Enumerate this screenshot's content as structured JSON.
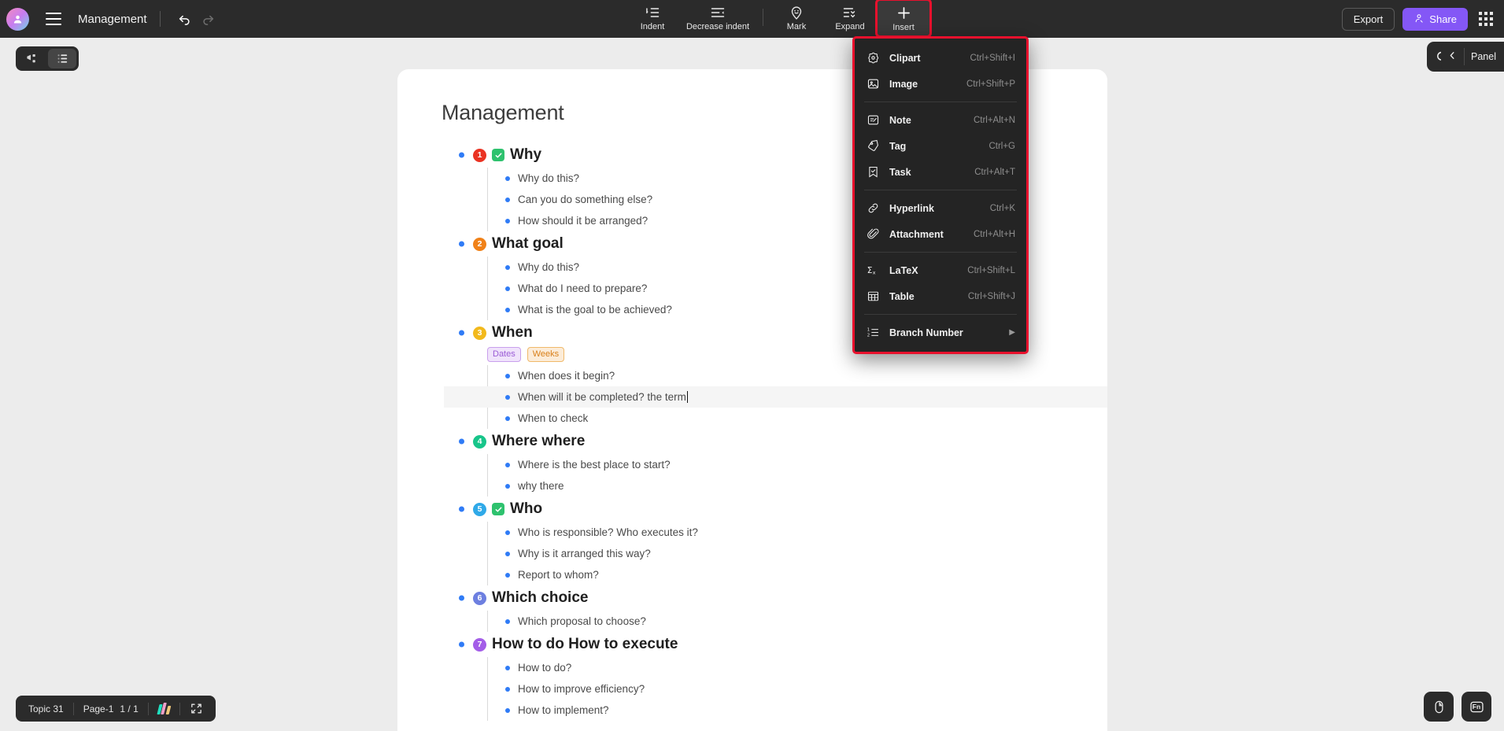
{
  "topbar": {
    "avatar_icon": "user-avatar-icon",
    "menu_icon": "hamburger-menu-icon",
    "title": "Management",
    "undo_icon": "undo-icon",
    "redo_icon": "redo-icon",
    "tools": [
      {
        "label": "Indent",
        "icon": "indent-icon"
      },
      {
        "label": "Decrease indent",
        "icon": "decrease-indent-icon"
      },
      {
        "label": "Mark",
        "icon": "mark-pin-icon"
      },
      {
        "label": "Expand",
        "icon": "expand-list-icon"
      },
      {
        "label": "Insert",
        "icon": "plus-icon"
      }
    ],
    "export_label": "Export",
    "share_label": "Share",
    "share_icon": "person-share-icon",
    "apps_icon": "apps-grid-icon",
    "accent_color": "#8457f6",
    "highlight_color": "#e8112d"
  },
  "insert_menu": {
    "items": [
      {
        "label": "Clipart",
        "shortcut": "Ctrl+Shift+I",
        "icon": "clipart-icon"
      },
      {
        "label": "Image",
        "shortcut": "Ctrl+Shift+P",
        "icon": "image-icon"
      },
      {
        "label": "Note",
        "shortcut": "Ctrl+Alt+N",
        "icon": "note-icon"
      },
      {
        "label": "Tag",
        "shortcut": "Ctrl+G",
        "icon": "tag-icon"
      },
      {
        "label": "Task",
        "shortcut": "Ctrl+Alt+T",
        "icon": "task-icon"
      },
      {
        "label": "Hyperlink",
        "shortcut": "Ctrl+K",
        "icon": "link-icon"
      },
      {
        "label": "Attachment",
        "shortcut": "Ctrl+Alt+H",
        "icon": "paperclip-icon"
      },
      {
        "label": "LaTeX",
        "shortcut": "Ctrl+Shift+L",
        "icon": "sigma-icon"
      },
      {
        "label": "Table",
        "shortcut": "Ctrl+Shift+J",
        "icon": "table-icon"
      },
      {
        "label": "Branch Number",
        "shortcut": "",
        "icon": "branch-number-icon",
        "submenu": true
      }
    ]
  },
  "view_toggle": {
    "mindmap_icon": "mindmap-view-icon",
    "outline_icon": "outline-view-icon",
    "selected": "outline"
  },
  "search": {
    "icon": "search-icon"
  },
  "panel": {
    "label": "Panel",
    "collapse_icon": "chevron-left-icon"
  },
  "statusbar": {
    "topic_count": "Topic 31",
    "page_label": "Page-1",
    "page_number": "1 / 1",
    "logo_icon": "brand-logo-icon",
    "fullscreen_icon": "fullscreen-icon"
  },
  "corner_buttons": [
    {
      "icon": "mouse-icon"
    },
    {
      "icon": "fn-key-icon"
    }
  ],
  "document": {
    "title": "Management",
    "nodes": [
      {
        "number": "1",
        "color": "#ea3323",
        "title": "Why",
        "checked": true,
        "children": [
          "Why do this?",
          "Can you do something else?",
          "How should it be arranged?"
        ]
      },
      {
        "number": "2",
        "color": "#f08118",
        "title": "What goal",
        "checked": false,
        "children": [
          "Why do this?",
          "What do I need to prepare?",
          "What is the goal to be achieved?"
        ]
      },
      {
        "number": "3",
        "color": "#f2b91c",
        "title": "When",
        "checked": false,
        "tags": [
          {
            "label": "Dates",
            "color": "#9b5cd6",
            "bg": "#f0e3fb",
            "border": "#c9a0ec"
          },
          {
            "label": "Weeks",
            "color": "#d9801a",
            "bg": "#fcecd8",
            "border": "#f0b96a"
          }
        ],
        "children": [
          "When does it begin?",
          "When will it be completed? the term",
          "When to check"
        ],
        "active_child": 1
      },
      {
        "number": "4",
        "color": "#18c58a",
        "title": "Where where",
        "checked": false,
        "children": [
          "Where is the best place to start?",
          "why there"
        ]
      },
      {
        "number": "5",
        "color": "#2fa9e8",
        "title": "Who",
        "checked": true,
        "children": [
          "Who is responsible? Who executes it?",
          "Why is it arranged this way?",
          "Report to whom?"
        ]
      },
      {
        "number": "6",
        "color": "#6d7fe0",
        "title": "Which choice",
        "checked": false,
        "children": [
          "Which proposal to choose?"
        ]
      },
      {
        "number": "7",
        "color": "#a35de8",
        "title": "How to do How to execute",
        "checked": false,
        "children": [
          "How to do?",
          "How to improve efficiency?",
          "How to implement?"
        ]
      }
    ]
  }
}
